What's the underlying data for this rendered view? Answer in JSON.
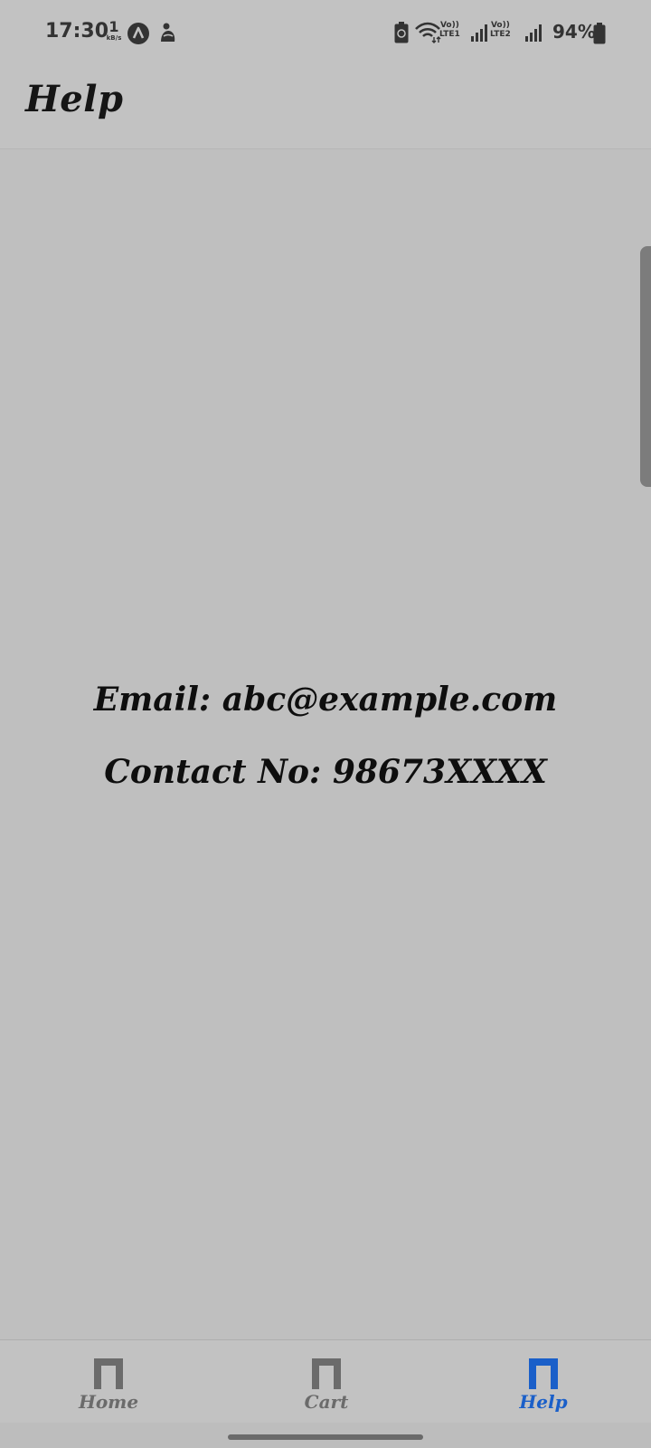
{
  "status_bar": {
    "time": "17:30",
    "net_speed_value": "1",
    "net_speed_unit": "kB/s",
    "sim1_label_top": "Vo))",
    "sim1_label_bottom": "LTE1",
    "sim2_label_top": "Vo))",
    "sim2_label_bottom": "LTE2",
    "battery_percent": "94%",
    "icons": [
      "a-notification-icon",
      "lady-bug-icon",
      "battery-saver-icon",
      "wifi-icon",
      "signal-icon",
      "signal-icon",
      "battery-icon"
    ]
  },
  "app_bar": {
    "title": "Help"
  },
  "content": {
    "email_line": "Email: abc@example.com",
    "contact_line": "Contact No: 98673XXXX"
  },
  "bottom_nav": {
    "items": [
      {
        "label": "Home",
        "icon": "tab-icon",
        "active": false
      },
      {
        "label": "Cart",
        "icon": "tab-icon",
        "active": false
      },
      {
        "label": "Help",
        "icon": "tab-icon",
        "active": true
      }
    ],
    "active_color": "#1a5fc9",
    "inactive_color": "#6b6b6b"
  }
}
